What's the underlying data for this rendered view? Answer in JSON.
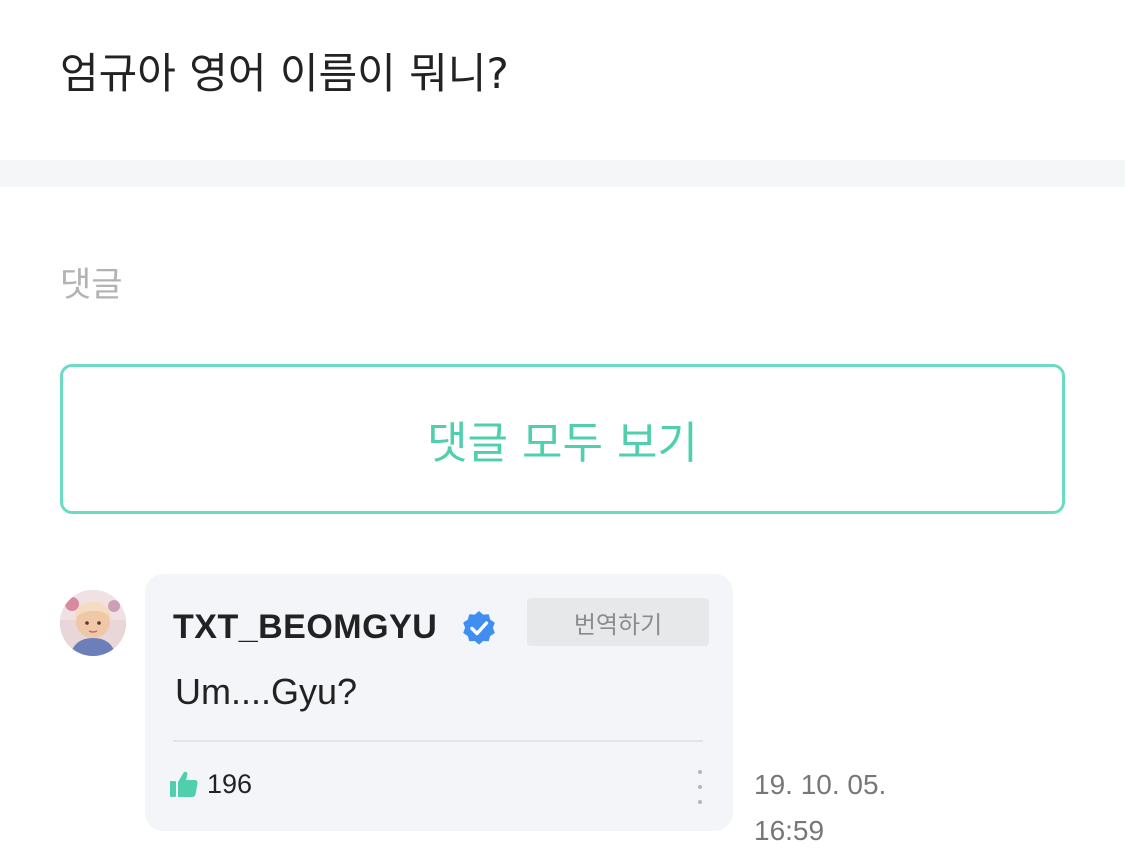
{
  "post": {
    "text": "엄규아 영어 이름이 뭐니?"
  },
  "comments_section": {
    "label": "댓글",
    "view_all_label": "댓글 모두 보기"
  },
  "comment": {
    "username": "TXT_BEOMGYU",
    "verified": true,
    "translate_label": "번역하기",
    "body": "Um....Gyu?",
    "like_count": "196",
    "date": "19. 10. 05.",
    "time": "16:59"
  },
  "icons": {
    "verified": "verified-check-icon",
    "like": "thumbs-up-icon",
    "more": "vertical-ellipsis-icon"
  },
  "colors": {
    "accent": "#4fcfae",
    "verified_blue": "#3f8ef0",
    "card_background": "#f4f5f8"
  }
}
